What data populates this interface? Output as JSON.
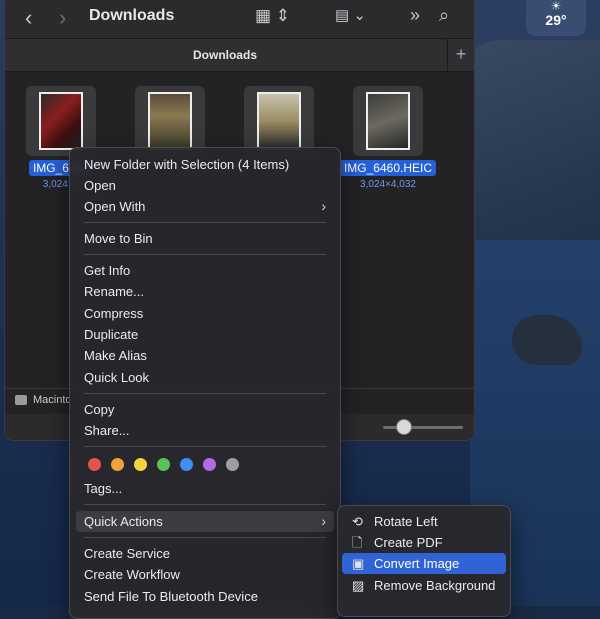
{
  "weather": {
    "icon": "sun-icon",
    "temperature": "29°"
  },
  "window": {
    "title": "Downloads",
    "tab_title": "Downloads",
    "path_bar_label": "Macinto"
  },
  "files": [
    {
      "name": "IMG_6457",
      "dimensions": "3,024×4"
    },
    {
      "name": "",
      "dimensions": ""
    },
    {
      "name": "",
      "dimensions": ""
    },
    {
      "name": "IMG_6460.HEIC",
      "dimensions": "3,024×4,032"
    }
  ],
  "context_menu": {
    "items": [
      "New Folder with Selection (4 Items)",
      "Open",
      "Open With",
      "Move to Bin",
      "Get Info",
      "Rename...",
      "Compress",
      "Duplicate",
      "Make Alias",
      "Quick Look",
      "Copy",
      "Share...",
      "Tags...",
      "Quick Actions",
      "Create Service",
      "Create Workflow",
      "Send File To Bluetooth Device"
    ],
    "tag_colors": [
      "#e5534b",
      "#f0a13a",
      "#f2d43c",
      "#57c25a",
      "#3f8ef0",
      "#b468e6",
      "#9e9ea3"
    ]
  },
  "quick_actions": {
    "items": [
      {
        "label": "Rotate Left",
        "icon": "rotate-left-icon"
      },
      {
        "label": "Create PDF",
        "icon": "document-icon"
      },
      {
        "label": "Convert Image",
        "icon": "convert-image-icon"
      },
      {
        "label": "Remove Background",
        "icon": "remove-background-icon"
      }
    ]
  }
}
